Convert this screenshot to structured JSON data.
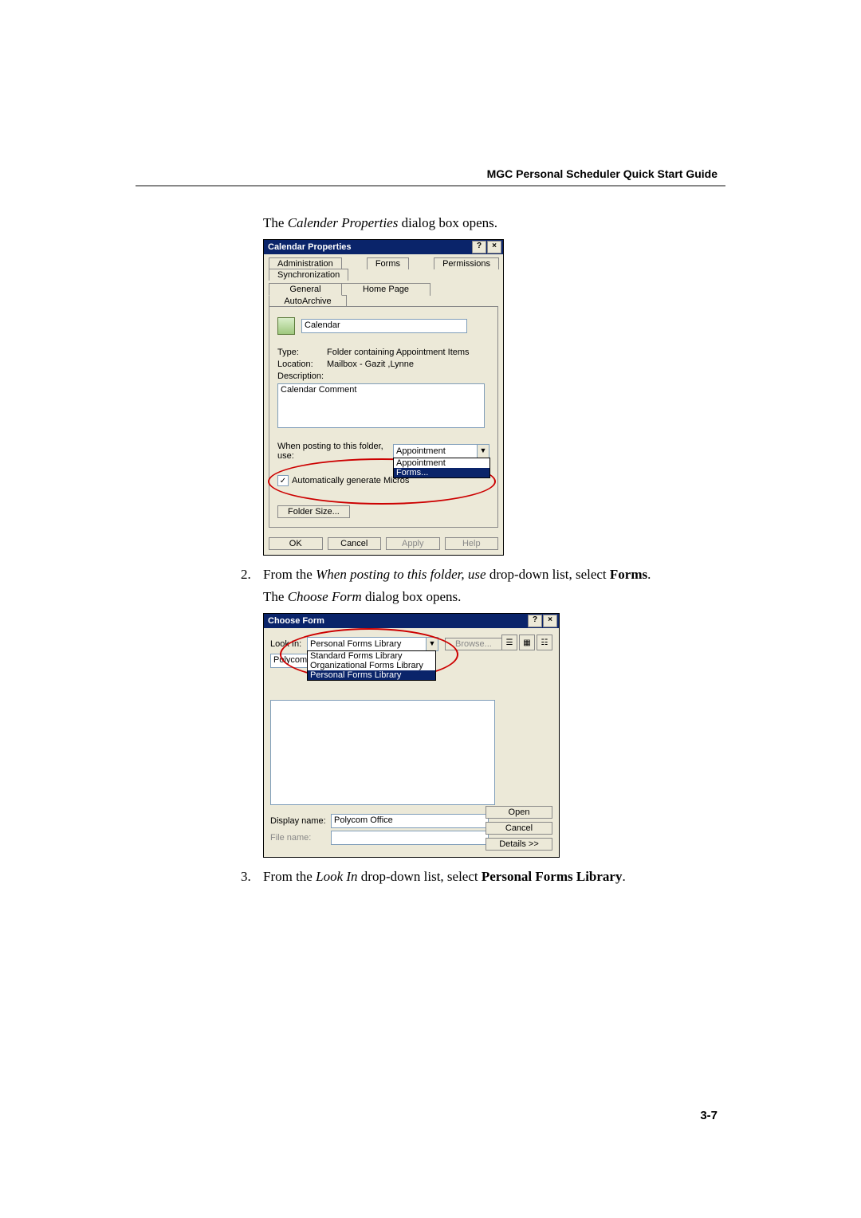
{
  "header": {
    "title": "MGC Personal Scheduler Quick Start Guide"
  },
  "text": {
    "line1_pre": "The ",
    "line1_italic": "Calender Properties",
    "line1_post": " dialog box opens.",
    "step2_num": "2.",
    "step2_pre": "From the ",
    "step2_italic": "When posting to this folder, use",
    "step2_mid": " drop-down list, select ",
    "step2_bold": "Forms",
    "step2_end": ".",
    "line2_pre": "The ",
    "line2_italic": "Choose Form",
    "line2_post": " dialog box opens.",
    "step3_num": "3.",
    "step3_pre": "From the ",
    "step3_italic": "Look In",
    "step3_mid": " drop-down list, select ",
    "step3_bold": "Personal Forms Library",
    "step3_end": "."
  },
  "calprops": {
    "title": "Calendar Properties",
    "help_btn": "?",
    "close_btn": "×",
    "tabs_back": [
      "Administration",
      "Forms",
      "Permissions",
      "Synchronization"
    ],
    "tabs_front": [
      "General",
      "Home Page",
      "AutoArchive"
    ],
    "name_value": "Calendar",
    "type_label": "Type:",
    "type_value": "Folder containing Appointment Items",
    "location_label": "Location:",
    "location_value": "Mailbox - Gazit ,Lynne",
    "description_label": "Description:",
    "description_value": "Calendar Comment",
    "posting_label": "When posting to this folder, use:",
    "posting_value": "Appointment",
    "posting_options": [
      "Appointment",
      "Forms..."
    ],
    "auto_gen": "Automatically generate Microsoft Exchange views",
    "auto_gen_prefix": "Automatically generate Micros",
    "folder_size": "Folder Size...",
    "buttons": {
      "ok": "OK",
      "cancel": "Cancel",
      "apply": "Apply",
      "help": "Help"
    }
  },
  "chooseform": {
    "title": "Choose Form",
    "help_btn": "?",
    "close_btn": "×",
    "lookin_label": "Look In:",
    "lookin_value": "Personal Forms Library",
    "lookin_options": [
      "Standard Forms Library",
      "Organizational Forms Library",
      "Personal Forms Library"
    ],
    "browse": "Browse...",
    "list_item": "Polycom",
    "display_label": "Display name:",
    "display_value": "Polycom Office",
    "file_label": "File name:",
    "file_value": "",
    "buttons": {
      "open": "Open",
      "cancel": "Cancel",
      "details": "Details >>"
    }
  },
  "page_number": "3-7"
}
